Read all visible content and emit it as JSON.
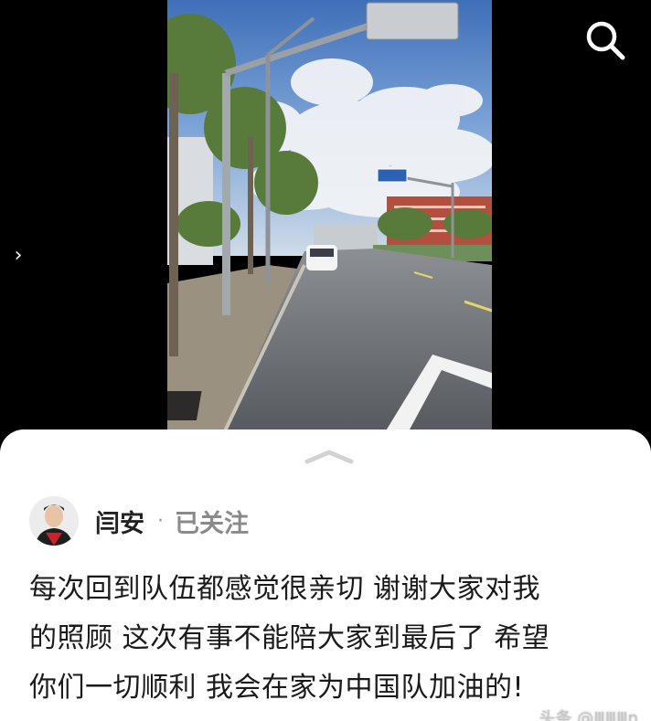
{
  "viewer": {
    "search_icon": "search-icon",
    "prev_icon": "chevron-right-icon",
    "prev_glyph": "›"
  },
  "sheet": {
    "handle_icon": "chevron-up-icon"
  },
  "author": {
    "name": "闫安",
    "separator": "·",
    "follow_status": "已关注"
  },
  "post": {
    "lines": [
      "每次回到队伍都感觉很亲切 谢谢大家对我",
      "的照顾 这次有事不能陪大家到最后了 希望",
      "你们一切顺利 我会在家为中国队加油的!"
    ]
  },
  "watermark": {
    "text": "头条 @ⅢⅢⅢn"
  },
  "colors": {
    "background": "#000000",
    "sheet": "#ffffff",
    "text": "#1a1a1a",
    "muted": "#8a8a8a"
  }
}
